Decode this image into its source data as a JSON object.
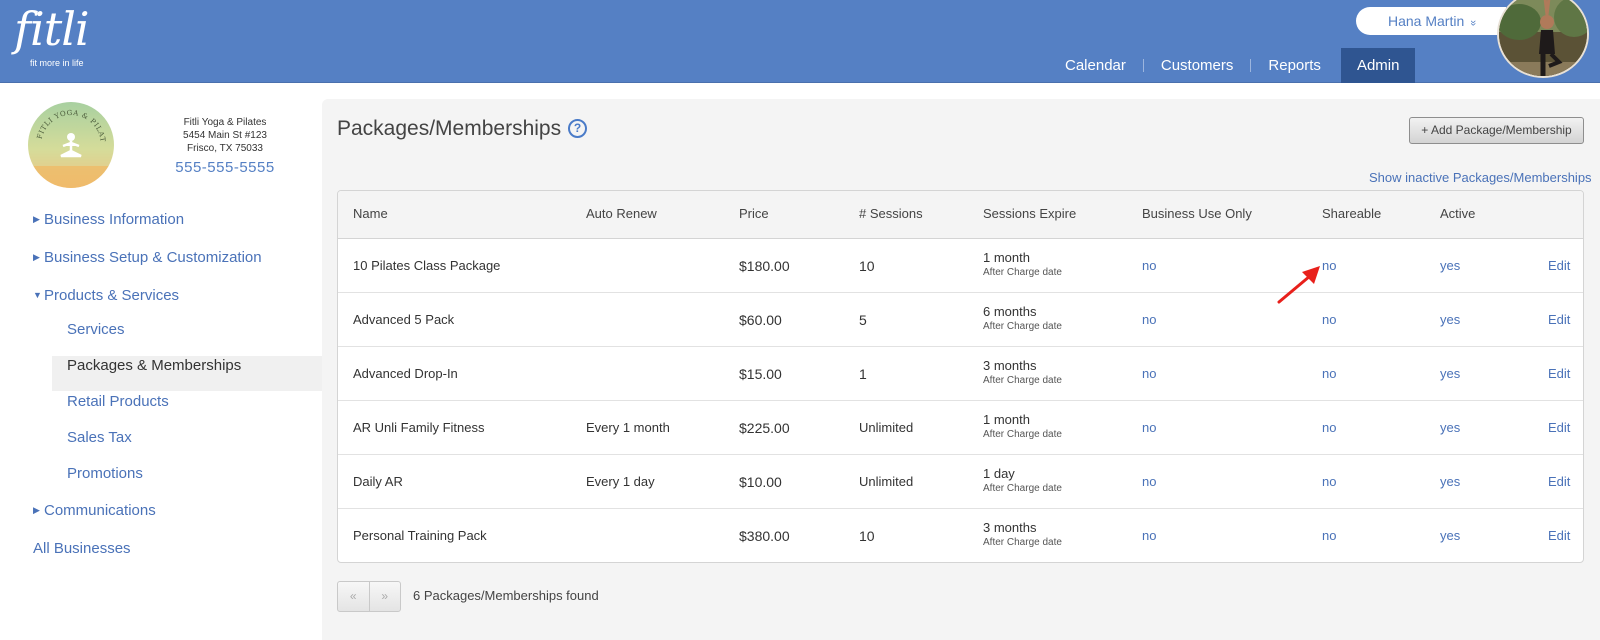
{
  "brand": {
    "wordmark": "fitli",
    "tagline": "fit more in life"
  },
  "user": {
    "name": "Hana Martin",
    "chevron": "»"
  },
  "nav": {
    "items": [
      {
        "label": "Calendar"
      },
      {
        "label": "Customers"
      },
      {
        "label": "Reports"
      },
      {
        "label": "Admin"
      }
    ],
    "active": "Admin"
  },
  "business": {
    "name": "Fitli Yoga & Pilates",
    "address1": "5454 Main St #123",
    "address2": "Frisco, TX 75033",
    "phone": "555-555-5555",
    "logo_text": "FITLI YOGA & PILATES"
  },
  "sidebar": {
    "business_information": "Business Information",
    "business_setup": "Business Setup & Customization",
    "products_services": "Products & Services",
    "services": "Services",
    "packages_memberships": "Packages & Memberships",
    "retail_products": "Retail Products",
    "sales_tax": "Sales Tax",
    "promotions": "Promotions",
    "communications": "Communications",
    "all_businesses": "All Businesses"
  },
  "main": {
    "title": "Packages/Memberships",
    "help": "?",
    "add_button": "+ Add Package/Membership",
    "show_inactive": "Show inactive Packages/Memberships",
    "columns": {
      "name": "Name",
      "auto_renew": "Auto Renew",
      "price": "Price",
      "sessions": "# Sessions",
      "expire": "Sessions Expire",
      "business_use": "Business Use Only",
      "shareable": "Shareable",
      "active": "Active"
    },
    "rows": [
      {
        "name": "10 Pilates Class Package",
        "auto_renew": "",
        "price": "$180.00",
        "sessions": "10",
        "expire": "1 month",
        "expire_sub": "After Charge date",
        "business_use": "no",
        "shareable": "no",
        "active": "yes",
        "edit": "Edit"
      },
      {
        "name": "Advanced 5 Pack",
        "auto_renew": "",
        "price": "$60.00",
        "sessions": "5",
        "expire": "6 months",
        "expire_sub": "After Charge date",
        "business_use": "no",
        "shareable": "no",
        "active": "yes",
        "edit": "Edit"
      },
      {
        "name": "Advanced Drop-In",
        "auto_renew": "",
        "price": "$15.00",
        "sessions": "1",
        "expire": "3 months",
        "expire_sub": "After Charge date",
        "business_use": "no",
        "shareable": "no",
        "active": "yes",
        "edit": "Edit"
      },
      {
        "name": "AR Unli Family Fitness",
        "auto_renew": "Every 1 month",
        "price": "$225.00",
        "sessions": "Unlimited",
        "expire": "1 month",
        "expire_sub": "After Charge date",
        "business_use": "no",
        "shareable": "no",
        "active": "yes",
        "edit": "Edit"
      },
      {
        "name": "Daily AR",
        "auto_renew": "Every 1 day",
        "price": "$10.00",
        "sessions": "Unlimited",
        "expire": "1 day",
        "expire_sub": "After Charge date",
        "business_use": "no",
        "shareable": "no",
        "active": "yes",
        "edit": "Edit"
      },
      {
        "name": "Personal Training Pack",
        "auto_renew": "",
        "price": "$380.00",
        "sessions": "10",
        "expire": "3 months",
        "expire_sub": "After Charge date",
        "business_use": "no",
        "shareable": "no",
        "active": "yes",
        "edit": "Edit"
      }
    ],
    "pager": {
      "prev": "«",
      "next": "»"
    },
    "found": "6 Packages/Memberships found"
  },
  "colors": {
    "header": "#5580c4",
    "active_nav": "#2f5591",
    "link": "#4a72b8",
    "annotation_arrow": "#e8201b"
  }
}
